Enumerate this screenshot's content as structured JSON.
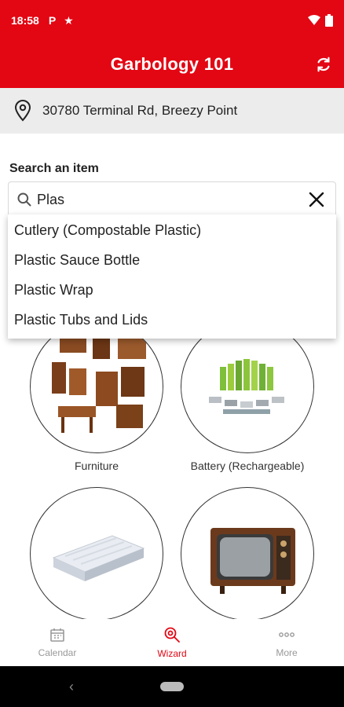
{
  "status_bar": {
    "time": "18:58",
    "left_icons": [
      "parking-icon",
      "star-icon"
    ],
    "right_icons": [
      "wifi-icon",
      "battery-icon"
    ]
  },
  "app_bar": {
    "title": "Garbology 101",
    "action_icon": "refresh-icon"
  },
  "address": {
    "icon": "location-pin-icon",
    "text": "30780 Terminal Rd, Breezy Point"
  },
  "search": {
    "label": "Search an item",
    "value": "Plas",
    "icon": "search-icon",
    "clear_icon": "close-icon"
  },
  "suggestions": [
    "Cutlery (Compostable Plastic)",
    "Plastic Sauce Bottle",
    "Plastic Wrap",
    "Plastic Tubs and Lids"
  ],
  "items": [
    {
      "label": "Furniture",
      "image": "furniture-image"
    },
    {
      "label": "Battery (Rechargeable)",
      "image": "battery-image"
    },
    {
      "label": "",
      "image": "mattress-image"
    },
    {
      "label": "",
      "image": "television-image"
    }
  ],
  "bottom_nav": {
    "items": [
      {
        "label": "Calendar",
        "icon": "calendar-icon",
        "active": false
      },
      {
        "label": "Wizard",
        "icon": "wizard-search-icon",
        "active": true
      },
      {
        "label": "More",
        "icon": "more-icon",
        "active": false
      }
    ]
  },
  "colors": {
    "brand": "#e30613",
    "address_bg": "#ececec",
    "nav_inactive": "#999999"
  }
}
